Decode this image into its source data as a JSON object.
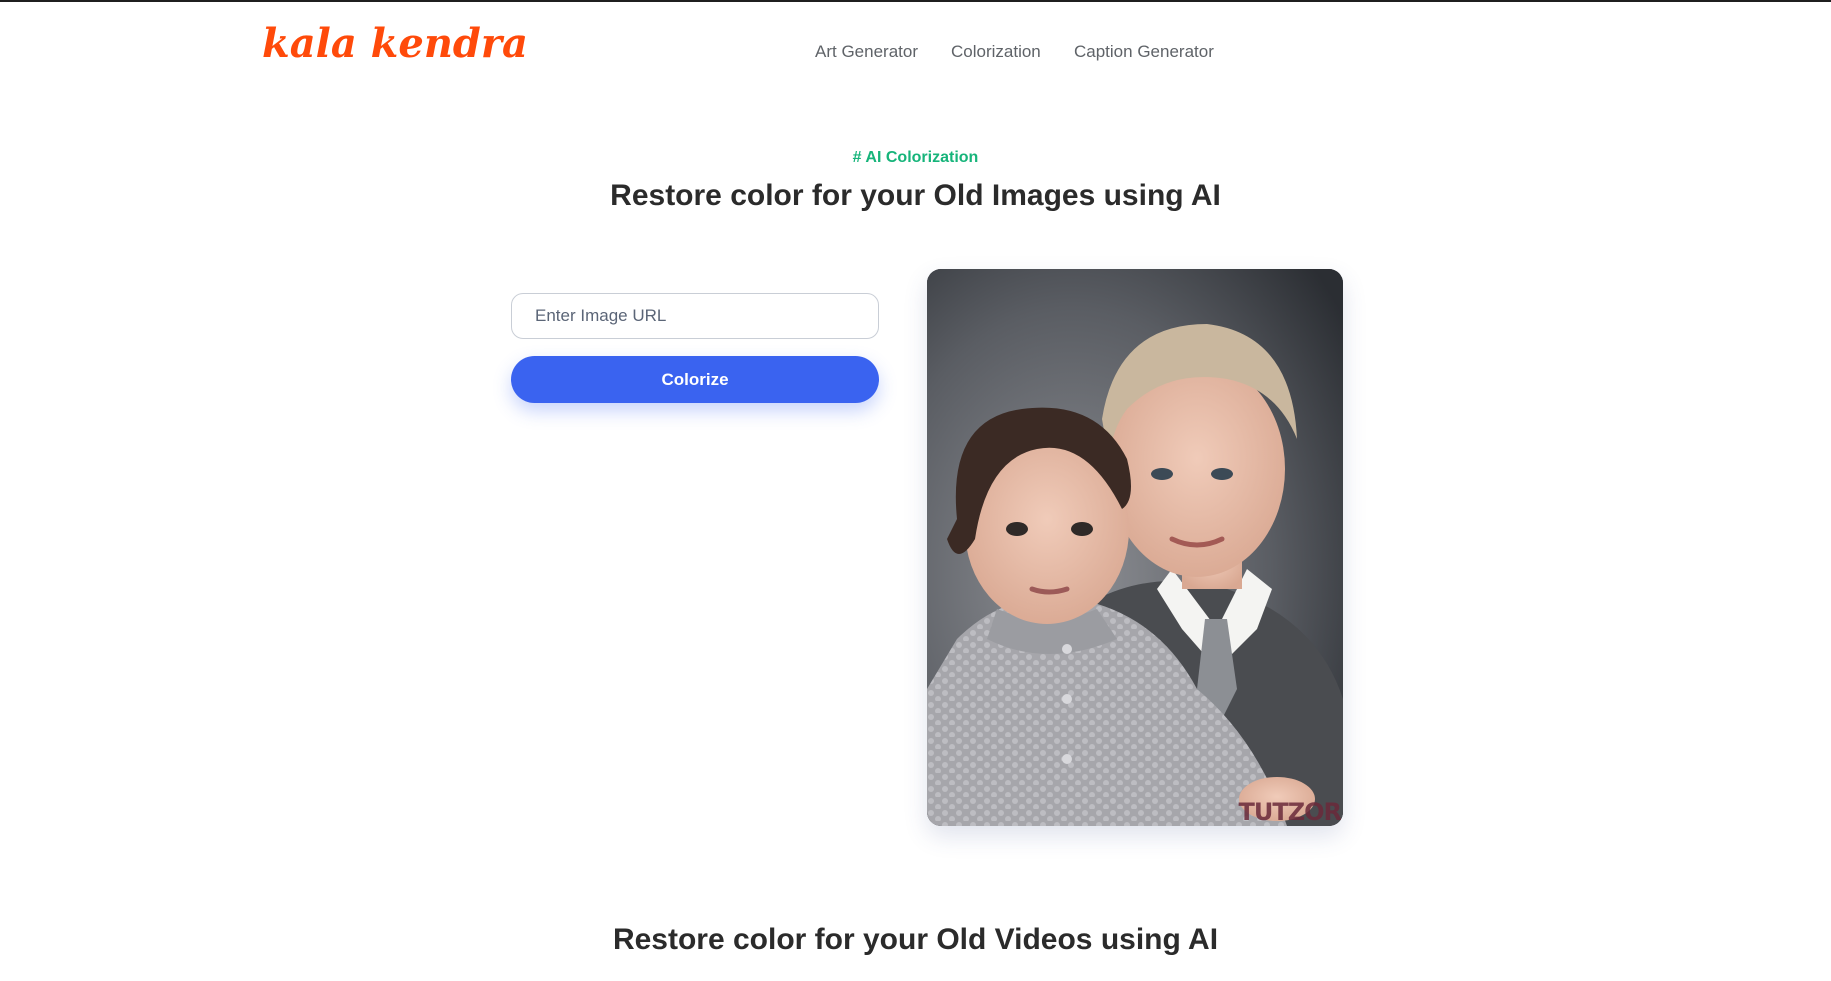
{
  "header": {
    "logo_text": "kala kendra",
    "nav": [
      {
        "label": "Art Generator"
      },
      {
        "label": "Colorization"
      },
      {
        "label": "Caption Generator"
      }
    ]
  },
  "hero": {
    "eyebrow": "# AI Colorization",
    "title": "Restore color for your Old Images using AI"
  },
  "form": {
    "url_placeholder": "Enter Image URL",
    "url_value": "",
    "submit_label": "Colorize"
  },
  "preview": {
    "watermark": "TUTZOR"
  },
  "section2": {
    "title": "Restore color for your Old Videos using AI"
  },
  "colors": {
    "brand": "#ff4a0a",
    "accent_green": "#16b47a",
    "primary_button": "#3a63f0"
  }
}
